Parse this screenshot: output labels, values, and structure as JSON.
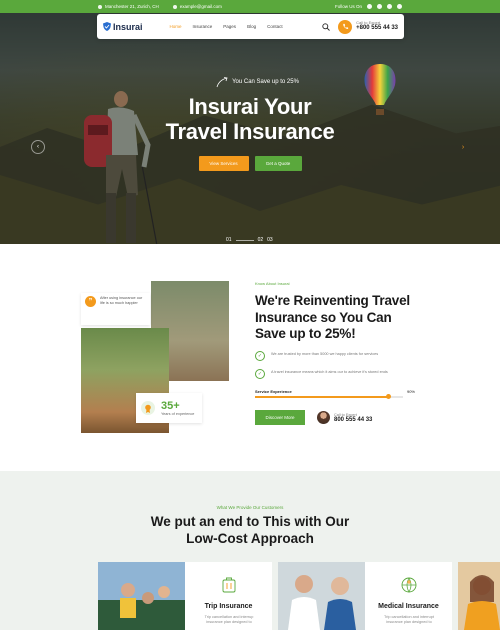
{
  "topbar": {
    "address": "Manchester 21, Zurich, CH",
    "email": "example@gmail.com",
    "follow": "Follow Us On"
  },
  "navbar": {
    "logo": "Insurai",
    "menu": [
      {
        "label": "Home",
        "active": true
      },
      {
        "label": "Insurance",
        "active": false
      },
      {
        "label": "Pages",
        "active": false
      },
      {
        "label": "Blog",
        "active": false
      },
      {
        "label": "Contact",
        "active": false
      }
    ],
    "call_label": "Call to Expert",
    "call_number": "+800 555 44 33"
  },
  "hero": {
    "save_text": "You Can Save up to 25%",
    "title_line1": "Insurai Your",
    "title_line2": "Travel Insurance",
    "btn_primary": "View Services",
    "btn_secondary": "Get a Quote",
    "slides": [
      "01",
      "02",
      "03"
    ]
  },
  "about": {
    "quote_text": "After using insurance our life is so much happier",
    "years_value": "35+",
    "years_label": "Years of experience",
    "kicker": "Know About Insurai",
    "title_line1": "We're Reinventing Travel",
    "title_line2": "Insurance so You Can",
    "title_line3": "Save up to 25%!",
    "points": [
      "We are trusted by more than 5000 we happy clients for services",
      "A travel insurance means which it aims our to achieve it's stored ends"
    ],
    "progress_label": "Service Experience",
    "progress_value_text": "90%",
    "progress_value": 0.9,
    "btn_more": "Discover More",
    "expert_label": "Call to Expert",
    "expert_number": "800 555 44 33"
  },
  "services": {
    "kicker": "What We Provide Our Customers",
    "title_line1": "We put an end to This with Our",
    "title_line2": "Low-Cost Approach",
    "cards": [
      {
        "title": "Trip Insurance",
        "desc": "Trip cancellation and interrup insurance plan designed to"
      },
      {
        "title": "Medical Insurance",
        "desc": "Trip cancellation and interrupt insurance plan designed to"
      }
    ]
  },
  "colors": {
    "green": "#5aa83c",
    "orange": "#f39a1c"
  }
}
